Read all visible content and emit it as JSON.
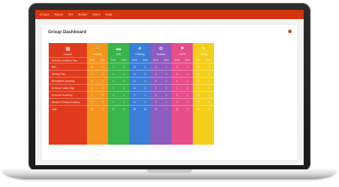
{
  "nav": {
    "items": [
      "Groups",
      "Report",
      "Hint",
      "Builder",
      "Users",
      "Trials"
    ]
  },
  "card": {
    "title": "Group Dashboard"
  },
  "table": {
    "account_header": "Account",
    "account_subheader": "Workflow Academy Plan",
    "accounts": [
      "Bats",
      "Overlay Plan",
      "Birmingham Academy",
      "Air Beach Valley High",
      "Somerset Academy",
      "Western Primary Academy",
      "Total"
    ],
    "groups": [
      {
        "label": "Ordinary",
        "icon": "lock-icon",
        "glyph": "🔒",
        "color": "#f7941d"
      },
      {
        "label": "MIS",
        "icon": "monitor-icon",
        "glyph": "▬",
        "color": "#39b54a"
      },
      {
        "label": "Phishing",
        "icon": "rocket-icon",
        "glyph": "✈",
        "color": "#3b7ed8"
      },
      {
        "label": "Updates",
        "icon": "gear-icon",
        "glyph": "⚙",
        "color": "#8e5bbf"
      },
      {
        "label": "GDPR",
        "icon": "user-icon",
        "glyph": "⚑",
        "color": "#e84c8b"
      },
      {
        "label": "Training",
        "icon": "pin-icon",
        "glyph": "✎",
        "color": "#f4cf1a"
      }
    ],
    "subcols": [
      "Done",
      "Open"
    ],
    "cells": [
      [
        [
          "8",
          "1"
        ],
        [
          "1",
          "3"
        ],
        [
          "12",
          "4"
        ],
        [
          "4",
          "1"
        ],
        [
          "3",
          "0"
        ],
        [
          "10",
          "1"
        ]
      ],
      [
        [
          "4",
          "2"
        ],
        [
          "2",
          "1"
        ],
        [
          "11",
          "3"
        ],
        [
          "3",
          "2"
        ],
        [
          "2",
          "1"
        ],
        [
          "9",
          "2"
        ]
      ],
      [
        [
          "6",
          "1"
        ],
        [
          "1",
          "0"
        ],
        [
          "10",
          "2"
        ],
        [
          "5",
          "1"
        ],
        [
          "4",
          "1"
        ],
        [
          "8",
          "0"
        ]
      ],
      [
        [
          "5",
          "3"
        ],
        [
          "2",
          "2"
        ],
        [
          "13",
          "5"
        ],
        [
          "2",
          "0"
        ],
        [
          "1",
          "2"
        ],
        [
          "7",
          "3"
        ]
      ],
      [
        [
          "7",
          "0"
        ],
        [
          "3",
          "1"
        ],
        [
          "9",
          "1"
        ],
        [
          "6",
          "2"
        ],
        [
          "3",
          "1"
        ],
        [
          "11",
          "1"
        ]
      ],
      [
        [
          "3",
          "2"
        ],
        [
          "1",
          "1"
        ],
        [
          "14",
          "3"
        ],
        [
          "3",
          "1"
        ],
        [
          "2",
          "0"
        ],
        [
          "6",
          "2"
        ]
      ],
      [
        [
          "33",
          "9"
        ],
        [
          "10",
          "8"
        ],
        [
          "69",
          "18"
        ],
        [
          "23",
          "7"
        ],
        [
          "15",
          "5"
        ],
        [
          "51",
          "9"
        ]
      ]
    ]
  },
  "colors": {
    "brand": "#d6330f",
    "account_col": "#e03a1c"
  }
}
